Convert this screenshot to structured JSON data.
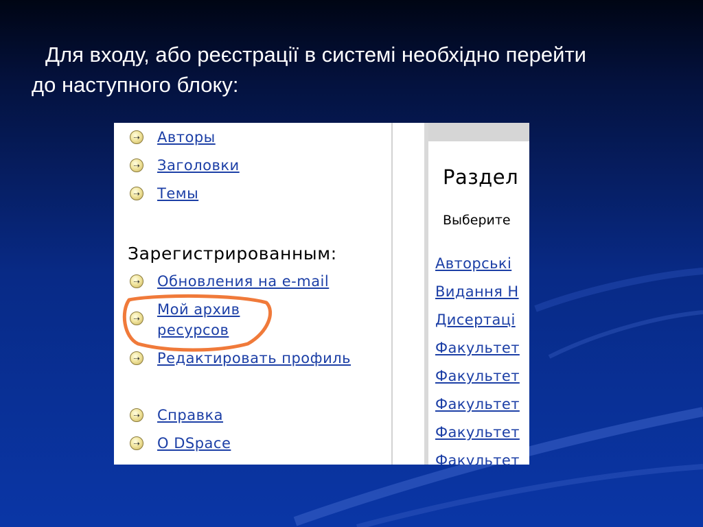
{
  "slide": {
    "line1": "Для входу, або реєстрації в системі необхідно перейти",
    "line2": "до наступного блоку:"
  },
  "left_nav": {
    "items_top": [
      {
        "label": "Авторы"
      },
      {
        "label": "Заголовки"
      },
      {
        "label": "Темы"
      }
    ],
    "section_title": "Зарегистрированным:",
    "items_registered": [
      {
        "label": "Обновления на e-mail"
      },
      {
        "label_line1": "Мой архив",
        "label_line2": "ресурсов",
        "highlighted": true
      },
      {
        "label": "Редактировать профиль"
      }
    ],
    "items_bottom": [
      {
        "label": "Справка"
      },
      {
        "label": "О DSpace"
      }
    ]
  },
  "right_panel": {
    "title": "Раздел",
    "subtitle": "Выберите",
    "links": [
      "Авторські",
      "Видання Н",
      "Дисертаці",
      "Факультет",
      "Факультет",
      "Факультет",
      "Факультет",
      "Факультет"
    ]
  },
  "colors": {
    "link": "#1c3fa6",
    "highlight": "#f07a3a",
    "background_top": "#000514",
    "background_bottom": "#0a36a6"
  },
  "icons": {
    "nav_bullet": "arrow-bullet-icon"
  }
}
